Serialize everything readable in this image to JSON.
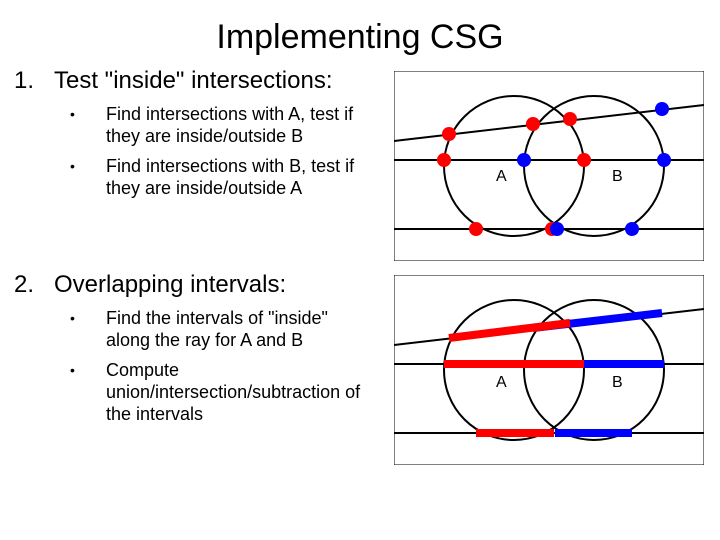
{
  "title": "Implementing CSG",
  "sections": [
    {
      "num": "1.",
      "heading": "Test \"inside\" intersections:",
      "bullets": [
        "Find intersections with A, test if they are inside/outside B",
        "Find intersections with B, test if they are inside/outside A"
      ]
    },
    {
      "num": "2.",
      "heading": "Overlapping intervals:",
      "bullets": [
        "Find the intervals of \"inside\" along the ray for A and B",
        "Compute union/intersection/subtraction of the intervals"
      ]
    }
  ],
  "fig_labels": {
    "A": "A",
    "B": "B"
  },
  "colors": {
    "red": "#ff0000",
    "blue": "#0000ff",
    "black": "#000000"
  }
}
